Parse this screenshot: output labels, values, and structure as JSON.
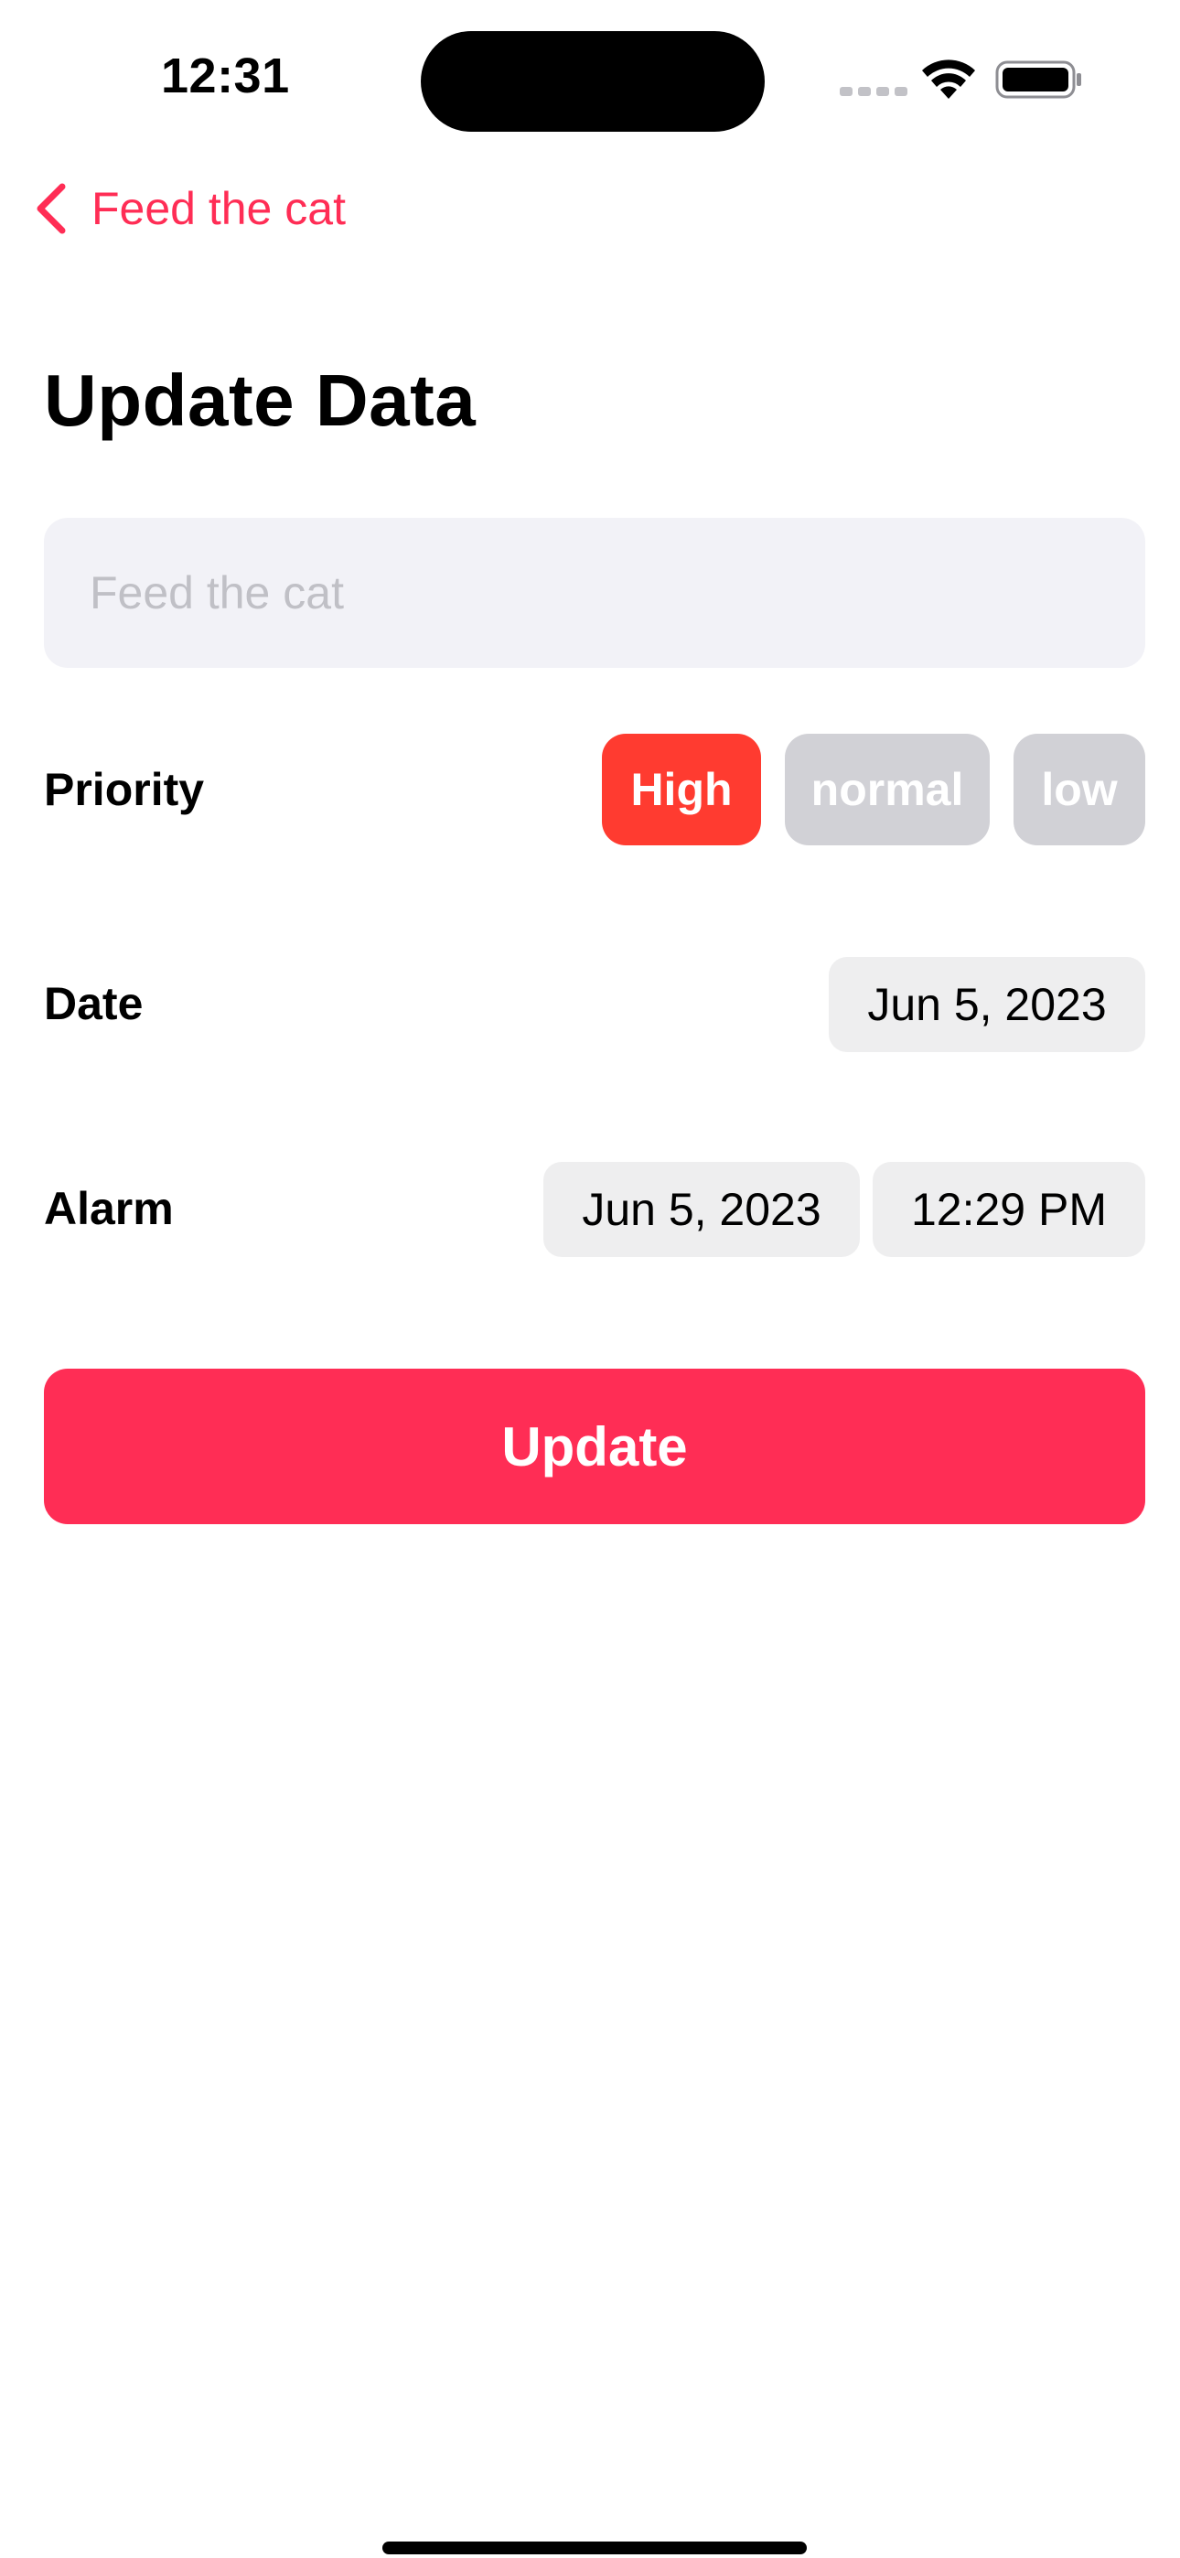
{
  "status_bar": {
    "time": "12:31"
  },
  "navigation": {
    "back_label": "Feed the cat",
    "back_icon": "chevron-left-icon"
  },
  "page": {
    "title": "Update Data"
  },
  "title_field": {
    "value": "",
    "placeholder": "Feed the cat"
  },
  "priority": {
    "label": "Priority",
    "options": [
      "High",
      "normal",
      "low"
    ],
    "selected": "High"
  },
  "date": {
    "label": "Date",
    "value": "Jun 5, 2023"
  },
  "alarm": {
    "label": "Alarm",
    "date": "Jun 5, 2023",
    "time": "12:29 PM"
  },
  "actions": {
    "update_label": "Update"
  },
  "colors": {
    "accent": "#ff2d55",
    "priority_selected": "#ff3b30",
    "chip_unselected": "#d1d1d6",
    "field_background": "#f2f2f7",
    "pill_background": "#eeeeef"
  }
}
